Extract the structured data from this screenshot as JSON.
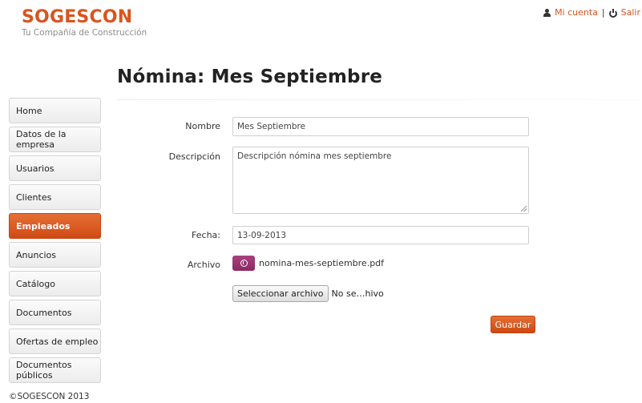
{
  "brand": {
    "name": "SOGESCON",
    "tagline": "Tu Compañía de Construcción"
  },
  "topnav": {
    "account_label": "Mi cuenta",
    "separator": "|",
    "logout_label": "Salir"
  },
  "page": {
    "title": "Nómina: Mes Septiembre"
  },
  "sidebar": {
    "items": [
      {
        "label": "Home",
        "active": false
      },
      {
        "label": "Datos de la empresa",
        "active": false
      },
      {
        "label": "Usuarios",
        "active": false
      },
      {
        "label": "Clientes",
        "active": false
      },
      {
        "label": "Empleados",
        "active": true
      },
      {
        "label": "Anuncios",
        "active": false
      },
      {
        "label": "Catálogo",
        "active": false
      },
      {
        "label": "Documentos",
        "active": false
      },
      {
        "label": "Ofertas de empleo",
        "active": false
      },
      {
        "label": "Documentos públicos",
        "active": false
      }
    ]
  },
  "form": {
    "nombre": {
      "label": "Nombre",
      "value": "Mes Septiembre"
    },
    "descripcion": {
      "label": "Descripción",
      "value": "Descripción nómina mes septiembre"
    },
    "fecha": {
      "label": "Fecha:",
      "value": "13-09-2013"
    },
    "archivo": {
      "label": "Archivo",
      "filename": "nomina-mes-septiembre.pdf"
    },
    "file_input": {
      "button_label": "Seleccionar archivo",
      "status": "No se…hivo"
    },
    "submit_label": "Guardar"
  },
  "footer": {
    "copyright": "©SOGESCON 2013"
  },
  "colors": {
    "accent": "#d9541e",
    "file_button": "#9b3571"
  }
}
